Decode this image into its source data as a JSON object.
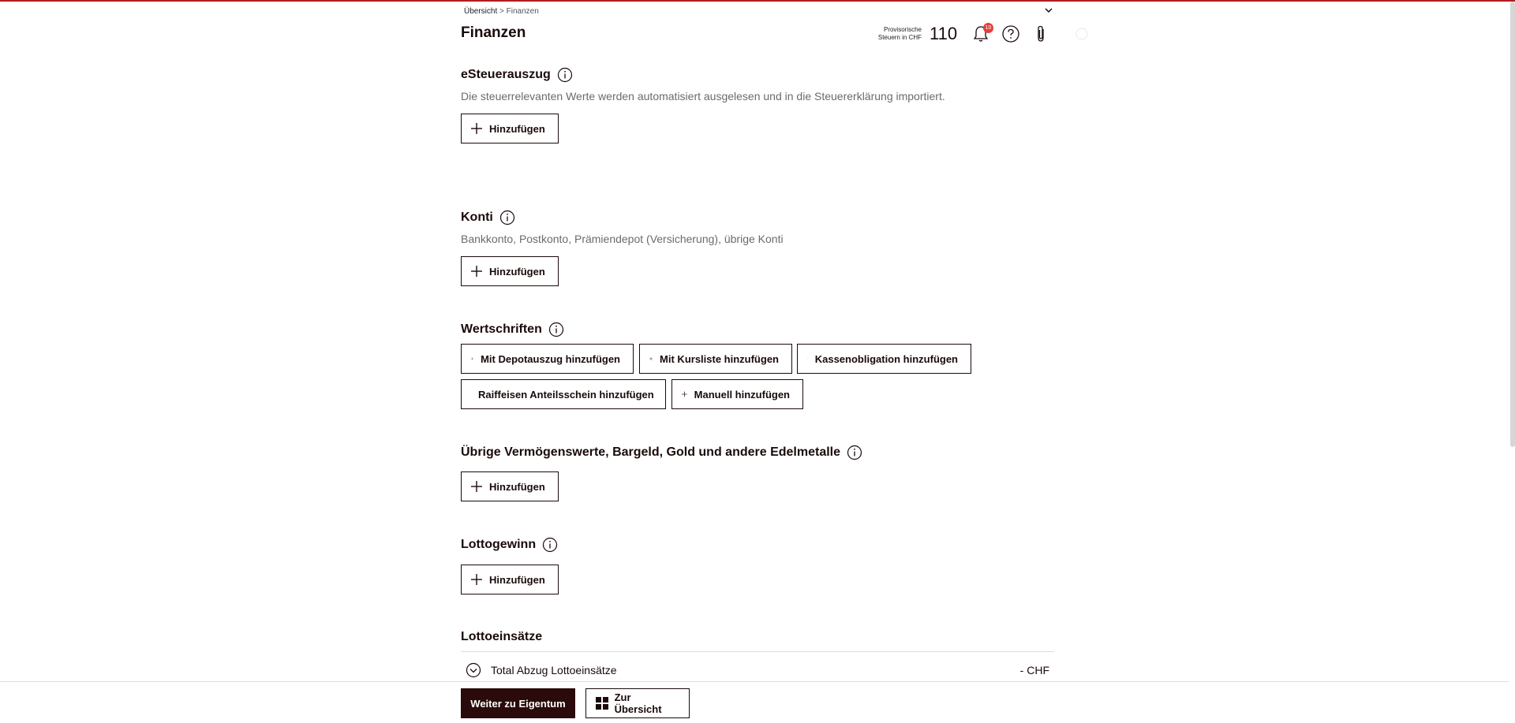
{
  "breadcrumb": {
    "home": "Übersicht",
    "separator": ">",
    "current": "Finanzen"
  },
  "page_title": "Finanzen",
  "tax": {
    "label": "Provisorische Steuern in CHF",
    "value": "110"
  },
  "notifications": {
    "count": "10"
  },
  "sections": {
    "esteuer": {
      "title": "eSteuerauszug",
      "desc": "Die steuerrelevanten Werte werden automatisiert ausgelesen und in die Steuererklärung importiert.",
      "button": "Hinzufügen"
    },
    "konti": {
      "title": "Konti",
      "desc": "Bankkonto, Postkonto, Prämiendepot (Versicherung), übrige Konti",
      "button": "Hinzufügen"
    },
    "wertschriften": {
      "title": "Wertschriften",
      "buttons": [
        "Mit Depotauszug hinzufügen",
        "Mit Kursliste hinzufügen",
        "Kassenobligation hinzufügen",
        "Raiffeisen Anteilsschein hinzufügen",
        "Manuell hinzufügen"
      ]
    },
    "uebrige": {
      "title": "Übrige Vermögenswerte, Bargeld, Gold und andere Edelmetalle",
      "button": "Hinzufügen"
    },
    "lotto": {
      "title": "Lottogewinn",
      "button": "Hinzufügen"
    },
    "lottoeinsaetze": {
      "title": "Lottoeinsätze",
      "total_label": "Total Abzug Lottoeinsätze",
      "total_value": "- CHF"
    }
  },
  "footer": {
    "next_label": "Weiter zu Eigentum",
    "overview_label": "Zur Übersicht"
  },
  "colors": {
    "accent": "#b01c1c",
    "primary_dark": "#2a0a0a",
    "badge": "#e2403a"
  }
}
